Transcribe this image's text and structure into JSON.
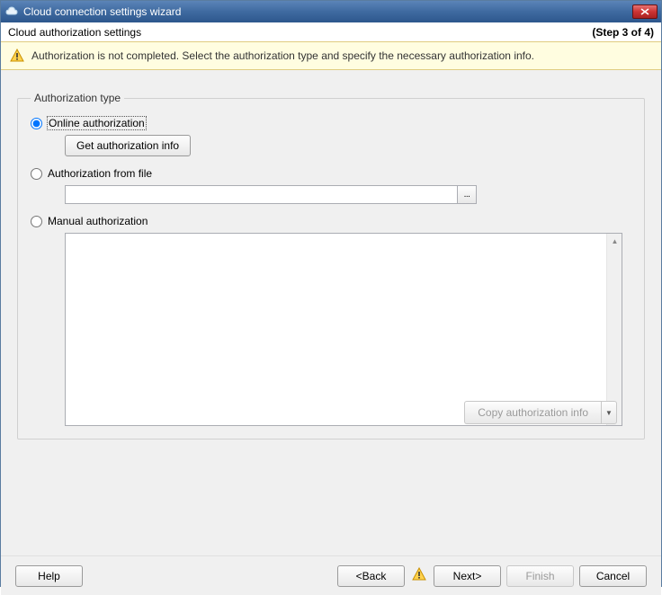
{
  "window": {
    "title": "Cloud connection settings wizard"
  },
  "subtitle": {
    "text": "Cloud authorization settings",
    "step": "(Step 3 of 4)"
  },
  "banner": {
    "text": "Authorization is not completed. Select the authorization type and specify the necessary authorization info."
  },
  "group": {
    "legend": "Authorization type",
    "online": {
      "label": "Online authorization",
      "button": "Get authorization info",
      "selected": true
    },
    "file": {
      "label": "Authorization from file",
      "value": "",
      "browse": "..."
    },
    "manual": {
      "label": "Manual authorization",
      "value": ""
    },
    "copy": {
      "label": "Copy authorization info"
    }
  },
  "footer": {
    "help": "Help",
    "back": "<Back",
    "next": "Next>",
    "finish": "Finish",
    "cancel": "Cancel"
  }
}
